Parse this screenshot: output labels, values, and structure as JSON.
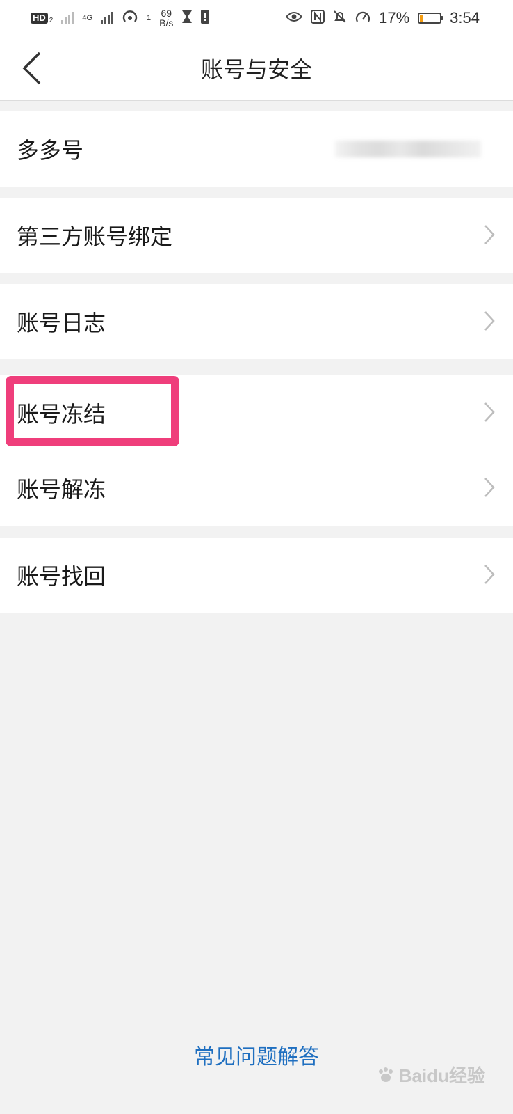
{
  "status_bar": {
    "hd_label": "HD",
    "hd_sub": "2",
    "network_type": "4G",
    "hotspot_count": "1",
    "net_speed_value": "69",
    "net_speed_unit": "B/s",
    "battery_percent_text": "17%",
    "battery_level": 0.17,
    "time": "3:54"
  },
  "header": {
    "title": "账号与安全",
    "back_icon": "chevron-left-icon"
  },
  "menu_groups": [
    {
      "items": [
        {
          "label": "多多号",
          "value_blurred": true
        }
      ]
    },
    {
      "items": [
        {
          "label": "第三方账号绑定",
          "icon": "chevron-right-icon"
        }
      ]
    },
    {
      "items": [
        {
          "label": "账号日志",
          "icon": "chevron-right-icon"
        }
      ]
    },
    {
      "items": [
        {
          "label": "账号冻结",
          "icon": "chevron-right-icon",
          "highlighted": true
        },
        {
          "label": "账号解冻",
          "icon": "chevron-right-icon"
        }
      ]
    },
    {
      "items": [
        {
          "label": "账号找回",
          "icon": "chevron-right-icon"
        }
      ]
    }
  ],
  "footer": {
    "faq_link": "常见问题解答"
  },
  "watermark": {
    "text": "Baidu经验"
  },
  "colors": {
    "highlight": "#ef3e7b",
    "link": "#1f6fc0",
    "background": "#f2f2f2",
    "battery_fill": "#f39c12"
  }
}
